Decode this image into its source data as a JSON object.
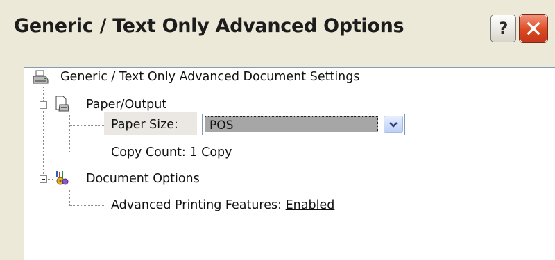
{
  "window": {
    "title": "Generic / Text Only Advanced Options",
    "help_label": "?",
    "close_label": "✕"
  },
  "tree": {
    "root_label": "Generic / Text Only Advanced Document Settings",
    "paper_output": {
      "label": "Paper/Output",
      "paper_size": {
        "label": "Paper Size:",
        "value": "POS"
      },
      "copy_count": {
        "label": "Copy Count:",
        "value": "1 Copy"
      }
    },
    "document_options": {
      "label": "Document Options",
      "advanced_printing": {
        "label": "Advanced Printing Features:",
        "value": "Enabled"
      }
    }
  }
}
